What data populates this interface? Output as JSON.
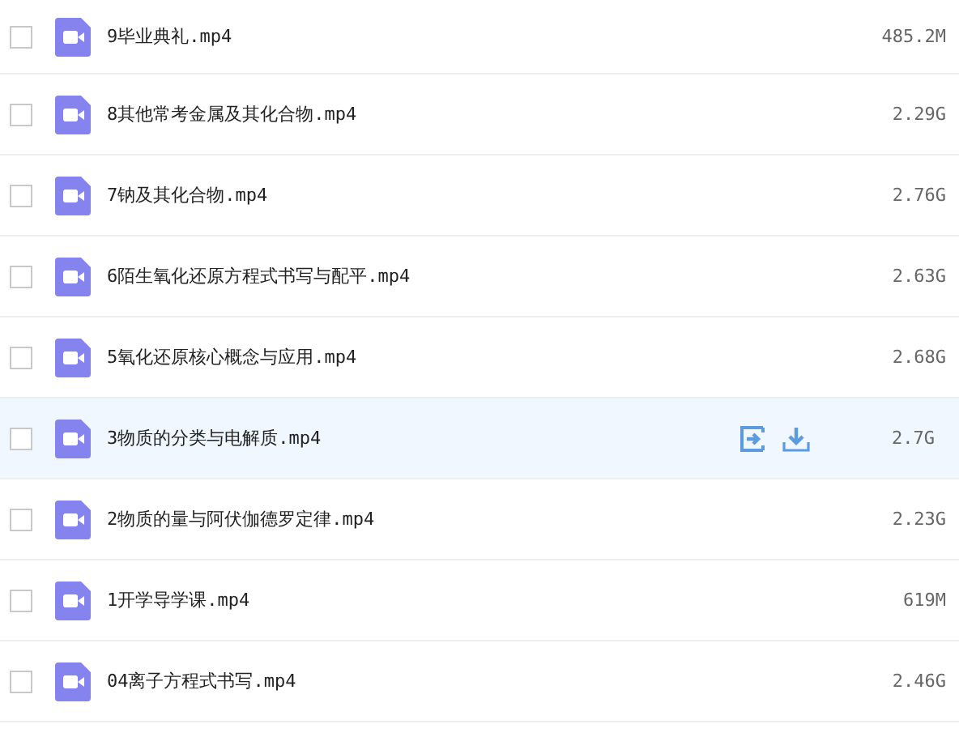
{
  "files": [
    {
      "name": "9毕业典礼.mp4",
      "size": "485.2M",
      "checked": false,
      "highlighted": false
    },
    {
      "name": "8其他常考金属及其化合物.mp4",
      "size": "2.29G",
      "checked": false,
      "highlighted": false
    },
    {
      "name": "7钠及其化合物.mp4",
      "size": "2.76G",
      "checked": false,
      "highlighted": false
    },
    {
      "name": "6陌生氧化还原方程式书写与配平.mp4",
      "size": "2.63G",
      "checked": false,
      "highlighted": false
    },
    {
      "name": "5氧化还原核心概念与应用.mp4",
      "size": "2.68G",
      "checked": false,
      "highlighted": false
    },
    {
      "name": "3物质的分类与电解质.mp4",
      "size": "2.7G",
      "checked": false,
      "highlighted": true
    },
    {
      "name": "2物质的量与阿伏伽德罗定律.mp4",
      "size": "2.23G",
      "checked": false,
      "highlighted": false
    },
    {
      "name": "1开学导学课.mp4",
      "size": "619M",
      "checked": false,
      "highlighted": false
    },
    {
      "name": "04离子方程式书写.mp4",
      "size": "2.46G",
      "checked": false,
      "highlighted": false
    }
  ]
}
